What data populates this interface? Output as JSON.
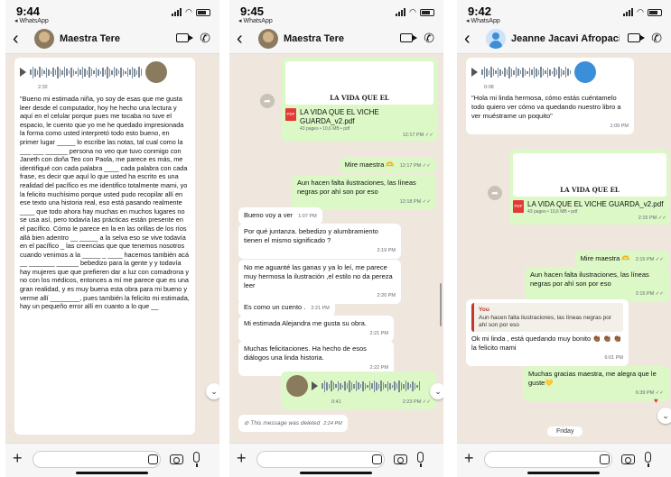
{
  "phones": [
    {
      "status": {
        "time": "9:44",
        "back_app": "◂ WhatsApp"
      },
      "header": {
        "contact": "Maestra Tere"
      },
      "audio_msg": {
        "duration": "2:32"
      },
      "long_message": "\"Bueno mi estimada niña, yo soy de esas que me gusta leer desde el computador, hoy he hecho una lectura y aquí en el celular porque pues me tocaba no tuve el espacio, le cuento que yo me he quedado impresionada la forma como usted interpretó todo esto bueno, en primer lugar _____ lo escribe las notas, tal cual como la ___ ___ ______ persona no veo que tuvo conmigo con Janeth con doña Teo con Paola, me parece es más, me identifiqué con cada palabra ____ cada palabra con cada frase, es decir que aquí lo que usted ha escrito es una realidad del pacífico es me identifico totalmente mami, yo la felicito muchísimo porque usted pudo recopilar allí en ese texto una historia real, eso está pasando realmente ____ que todo ahora hay muchas en muchos lugares no se usa así, pero todavía las prácticas están presente en el pacífico. Cómo le parece en la en las orillas de los ríos allá bien adentro __ _____ a la selva eso se vive todavía en el pacífico _ las creencias que que tenemos nosotros cuando venimos a la _____ _ ____ hacemos también acá __ _______ ______ bebedizo para la gente y y todavía hay mujeres que que prefieren dar a luz con comadrona y no con los médicos, entonces a mí me parece que es una gran realidad, y es muy buena esta obra para mi bueno y verme allí ________, pues también la felicito mi estimada, hay un pequeño error allí en cuanto a lo que __"
    },
    {
      "status": {
        "time": "9:45",
        "back_app": "◂ WhatsApp"
      },
      "header": {
        "contact": "Maestra Tere"
      },
      "pdf": {
        "thumb_title": "LA VIDA QUE EL",
        "name": "LA VIDA QUE EL VICHE GUARDA_v2.pdf",
        "meta": "43 pages • 10,6 MB • pdf",
        "time": "12:17 PM ✓✓"
      },
      "messages": [
        {
          "text": "Mire maestra 🫶",
          "time": "12:17 PM ✓✓"
        },
        {
          "text": "Aun hacen falta ilustraciones, las líneas negras por ahí son por eso",
          "time": "12:18 PM ✓✓"
        },
        {
          "text": "Bueno voy a ver",
          "time": "1:07 PM"
        },
        {
          "text": "Por qué juntanza. bebedizo y alumbramiento tienen el mismo significado ?",
          "time": "2:19 PM"
        },
        {
          "text": "No me aguanté las ganas y ya lo leí, me parece muy hermosa la ilustración ,el estilo no da pereza leer",
          "time": "2:20 PM"
        },
        {
          "text": "Es como un cuento .",
          "time": "2:21 PM"
        },
        {
          "text": "Mi estimada Alejandra me gusta su obra.",
          "time": "2:21 PM"
        },
        {
          "text": "Muchas felicitaciones. Ha hecho de esos diálogos una linda historia.",
          "time": "2:22 PM"
        }
      ],
      "audio_out": {
        "duration": "0:41",
        "time": "2:23 PM ✓✓"
      },
      "deleted": {
        "text": "⊘ This message was deleted",
        "time": "2:24 PM"
      }
    },
    {
      "status": {
        "time": "9:42",
        "back_app": "◂ WhatsApp"
      },
      "header": {
        "contact": "Jeanne Jacavi Afropacif..."
      },
      "audio_msg": {
        "duration": "0:08"
      },
      "transcript": {
        "text": "\"Hola mi linda hermosa, cómo estás cuéntamelo todo quiero ver cómo va quedando nuestro libro a ver muéstrame un poquito\"",
        "time": "1:09 PM"
      },
      "pdf": {
        "thumb_title": "LA VIDA QUE EL",
        "name": "LA VIDA QUE EL VICHE GUARDA_v2.pdf",
        "meta": "43 pages • 10,6 MB • pdf",
        "time": "2:15 PM ✓✓"
      },
      "messages": [
        {
          "text": "Mire maestra 🫶",
          "time": "2:15 PM ✓✓"
        },
        {
          "text": "Aun hacen falta ilustraciones, las líneas negras por ahí son por eso",
          "time": "2:15 PM ✓✓"
        }
      ],
      "reply": {
        "quote_author": "You",
        "quote_text": "Aun hacen falta ilustraciones, las líneas negras por ahí son por eso",
        "text": "Ok mi linda , está quedando muy bonito 👏🏾 👏🏾 👏🏾 la felicito mami",
        "time": "6:01 PM"
      },
      "thanks": {
        "text": "Muchas gracias maestra, me alegra que le guste💛",
        "time": "6:39 PM ✓✓"
      },
      "date_pill": "Friday"
    }
  ]
}
